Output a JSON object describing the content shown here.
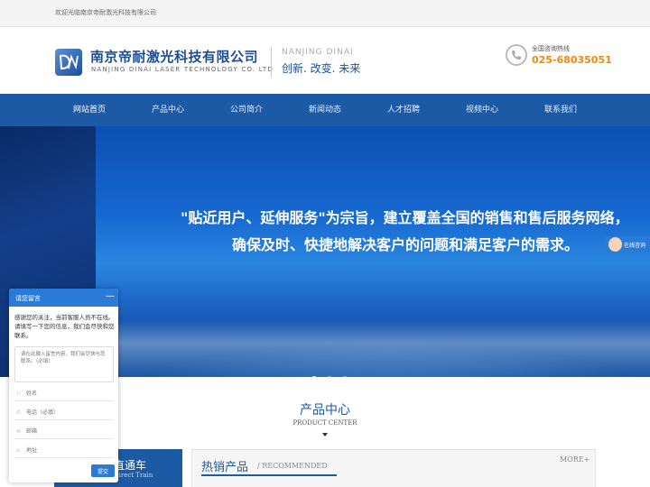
{
  "topbar": {
    "welcome": "欢迎光临南京帝耐激光科技有限公司"
  },
  "header": {
    "company_cn": "南京帝耐激光科技有限公司",
    "company_en": "NANJING DINAI LASER TECHNOLOGY CO. LTD",
    "slogan_en": "NANJING DINAI",
    "slogan_cn": "创新. 改变. 未来",
    "hotline_label": "全国咨询热线",
    "hotline_number": "025-68035051",
    "accent": "#f08a0a",
    "brand": "#1d5aa6"
  },
  "nav": {
    "items": [
      {
        "label": "网站首页"
      },
      {
        "label": "产品中心"
      },
      {
        "label": "公司简介"
      },
      {
        "label": "新闻动态"
      },
      {
        "label": "人才招聘"
      },
      {
        "label": "视频中心"
      },
      {
        "label": "联系我们"
      }
    ]
  },
  "banner": {
    "line1": "\"贴近用户、延伸服务\"为宗旨，建立覆盖全国的销售和售后服务网络，",
    "line2": "确保及时、快捷地解决客户的问题和满足客户的需求。"
  },
  "online": {
    "label": "在线咨询"
  },
  "products": {
    "title": "产品中心",
    "subtitle": "PRODUCT CENTER",
    "category_title": "直通车",
    "category_sub": "Direct Train",
    "hot_title": "热销产品",
    "hot_sub": "/ RECOMMENDED",
    "more": "MORE+"
  },
  "chat": {
    "title": "请您留言",
    "minimize": "—",
    "message": "感谢您的关注，当前客服人员不在线。请填写一下您的信息，我们会尽快和您联系。",
    "textarea_placeholder": "请在此输入留言内容，我们会尽快与您联系。（必填）",
    "fields": [
      {
        "icon": "user-icon",
        "glyph": "⚇",
        "placeholder": "姓名"
      },
      {
        "icon": "phone-icon",
        "glyph": "✆",
        "placeholder": "电话（必填）"
      },
      {
        "icon": "mail-icon",
        "glyph": "✉",
        "placeholder": "邮箱"
      },
      {
        "icon": "location-icon",
        "glyph": "⌂",
        "placeholder": "地址"
      }
    ],
    "submit": "提交"
  }
}
